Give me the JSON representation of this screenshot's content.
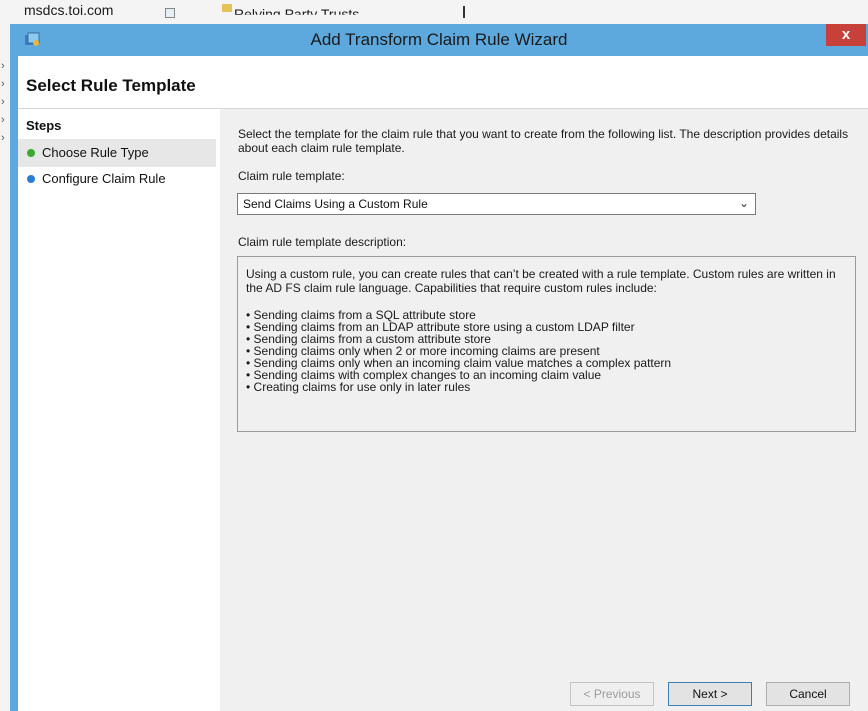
{
  "background": {
    "domain_text": "msdcs.toi.com",
    "tab_text": "Relying Party Trusts"
  },
  "window": {
    "title": "Add Transform Claim Rule Wizard",
    "close_glyph": "x",
    "app_icon": "adfs-icon",
    "colors": {
      "title_bar": "#5da8dc",
      "close": "#c7403a"
    }
  },
  "header": {
    "title": "Select Rule Template"
  },
  "steps": {
    "heading": "Steps",
    "items": [
      {
        "label": "Choose Rule Type",
        "dot_color": "#3aa832",
        "active": true
      },
      {
        "label": "Configure Claim Rule",
        "dot_color": "#2e7bd6",
        "active": false
      }
    ]
  },
  "main": {
    "intro": "Select the template for the claim rule that you want to create from the following list. The description provides details about each claim rule template.",
    "template_label": "Claim rule template:",
    "template_value": "Send Claims Using a Custom Rule",
    "description_label": "Claim rule template description:",
    "description_text": "Using a custom rule, you can create rules that can’t be created with a rule template.  Custom rules are written in the AD FS claim rule language.  Capabilities that require custom rules include:",
    "bullets": [
      "• Sending claims from a SQL attribute store",
      "• Sending claims from an LDAP attribute store using a custom LDAP filter",
      "• Sending claims from a custom attribute store",
      "• Sending claims only when 2 or more incoming claims are present",
      "• Sending claims only when an incoming claim value matches a complex pattern",
      "• Sending claims with complex changes to an incoming claim value",
      "• Creating claims for use only in later rules"
    ]
  },
  "buttons": {
    "previous": "< Previous",
    "next": "Next >",
    "cancel": "Cancel"
  }
}
